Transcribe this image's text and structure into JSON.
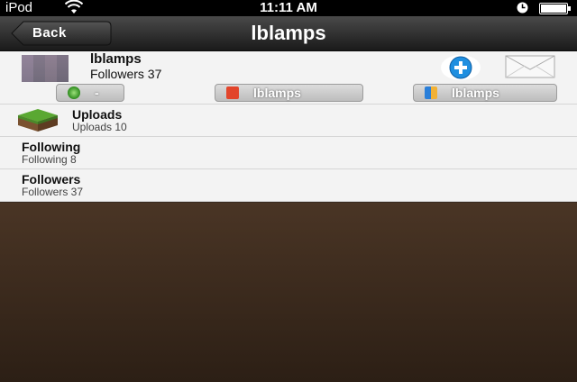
{
  "status_bar": {
    "carrier": "iPod",
    "time": "11:11 AM"
  },
  "nav": {
    "back_label": "Back",
    "title": "lblamps"
  },
  "profile": {
    "name": "lblamps",
    "followers_line": "Followers 37",
    "links": [
      {
        "label": "-",
        "icon": "xbox-icon"
      },
      {
        "label": "lblamps",
        "icon": "app-icon"
      },
      {
        "label": "lblamps",
        "icon": "game-center-icon"
      }
    ]
  },
  "list": {
    "items": [
      {
        "title": "Uploads",
        "subtitle": "Uploads 10",
        "icon": "grass-block-icon"
      },
      {
        "title": "Following",
        "subtitle": "Following 8"
      },
      {
        "title": "Followers",
        "subtitle": "Followers 37"
      }
    ]
  },
  "colors": {
    "nav_bg": "#2b2b2b",
    "follow_button": "#1f8fe0",
    "background": "#3a2a1f"
  }
}
